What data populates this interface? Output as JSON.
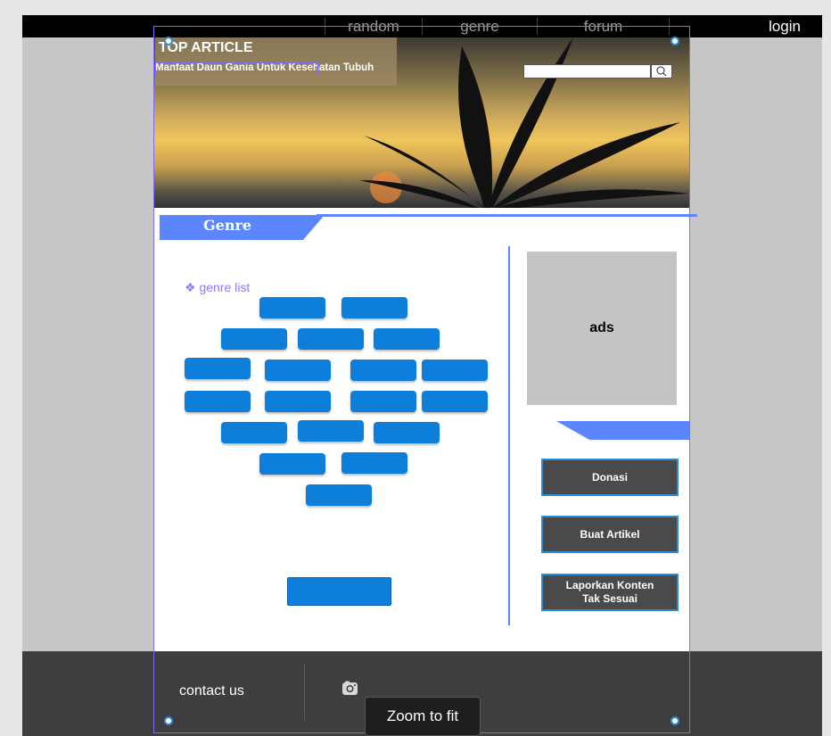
{
  "nav": {
    "items": [
      {
        "label": "random"
      },
      {
        "label": "genre"
      },
      {
        "label": "forum"
      }
    ],
    "login_label": "login"
  },
  "hero": {
    "heading": "TOP ARTICLE",
    "article_title": "Manfaat Daun Gania Untuk Kesehatan Tubuh",
    "search_value": "",
    "search_icon": "search-icon"
  },
  "genre": {
    "title": "Genre",
    "list_label": "❖ genre list",
    "button_count_shown": 20
  },
  "sidebar": {
    "ads_label": "ads",
    "buttons": [
      {
        "label": "Donasi"
      },
      {
        "label": "Buat Artikel"
      },
      {
        "label": "Laporkan Konten Tak Sesuai"
      }
    ]
  },
  "footer": {
    "contact_label": "contact us",
    "social_icon": "instagram-icon"
  },
  "toolbar": {
    "zoom_label": "Zoom to fit"
  },
  "colors": {
    "accent": "#5b86ff",
    "button_blue": "#0e7edb",
    "nav_bg": "#000000",
    "footer_bg": "#3e3e41",
    "selection": "#7a6cff"
  }
}
